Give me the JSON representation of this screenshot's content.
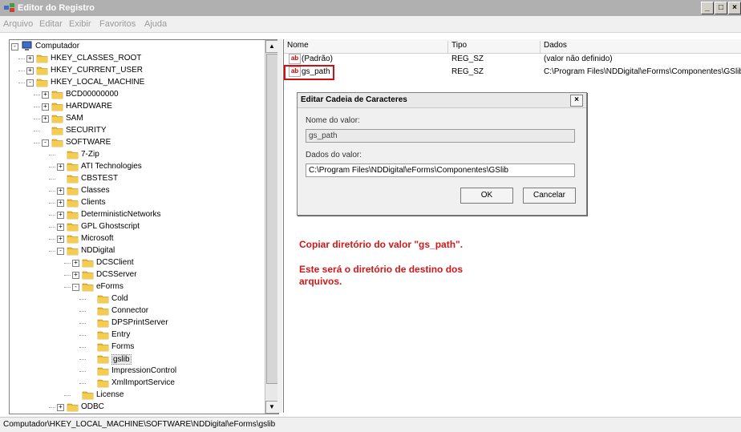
{
  "window": {
    "title": "Editor do Registro",
    "controls": [
      "_",
      "□",
      "×"
    ]
  },
  "menu": [
    "Arquivo",
    "Editar",
    "Exibir",
    "Favoritos",
    "Ajuda"
  ],
  "tree": {
    "root": "Computador",
    "nodes": [
      {
        "label": "HKEY_CLASSES_ROOT"
      },
      {
        "label": "HKEY_CURRENT_USER"
      },
      {
        "label": "HKEY_LOCAL_MACHINE"
      },
      {
        "label": "BCD00000000"
      },
      {
        "label": "HARDWARE"
      },
      {
        "label": "SAM"
      },
      {
        "label": "SECURITY"
      },
      {
        "label": "SOFTWARE"
      },
      {
        "label": "7-Zip"
      },
      {
        "label": "ATI Technologies"
      },
      {
        "label": "CBSTEST"
      },
      {
        "label": "Classes"
      },
      {
        "label": "Clients"
      },
      {
        "label": "DeterministicNetworks"
      },
      {
        "label": "GPL Ghostscript"
      },
      {
        "label": "Microsoft"
      },
      {
        "label": "NDDigital"
      },
      {
        "label": "DCSClient"
      },
      {
        "label": "DCSServer"
      },
      {
        "label": "eForms"
      },
      {
        "label": "Cold"
      },
      {
        "label": "Connector"
      },
      {
        "label": "DPSPrintServer"
      },
      {
        "label": "Entry"
      },
      {
        "label": "Forms"
      },
      {
        "label": "gslib"
      },
      {
        "label": "ImpressionControl"
      },
      {
        "label": "XmlImportService"
      },
      {
        "label": "License"
      },
      {
        "label": "ODBC"
      }
    ]
  },
  "values": {
    "headers": [
      "Nome",
      "Tipo",
      "Dados"
    ],
    "rows": [
      {
        "name": "(Padrão)",
        "type": "REG_SZ",
        "data": "(valor não definido)"
      },
      {
        "name": "gs_path",
        "type": "REG_SZ",
        "data": "C:\\Program Files\\NDDigital\\eForms\\Componentes\\GSlib"
      }
    ],
    "icon_text": "ab"
  },
  "dialog": {
    "title": "Editar Cadeia de Caracteres",
    "close": "×",
    "name_label": "Nome do valor:",
    "name_value": "gs_path",
    "data_label": "Dados do valor:",
    "data_value": "C:\\Program Files\\NDDigital\\eForms\\Componentes\\GSlib",
    "ok": "OK",
    "cancel": "Cancelar"
  },
  "instructions": {
    "line1": "Copiar diretório do valor \"gs_path\".",
    "line2": "Este será o diretório de destino dos",
    "line3": "arquivos."
  },
  "status": "Computador\\HKEY_LOCAL_MACHINE\\SOFTWARE\\NDDigital\\eForms\\gslib",
  "colors": {
    "annotation": "#d01818",
    "folder": "#e8b830"
  },
  "scrollbar": {
    "up": "▲",
    "down": "▼"
  }
}
